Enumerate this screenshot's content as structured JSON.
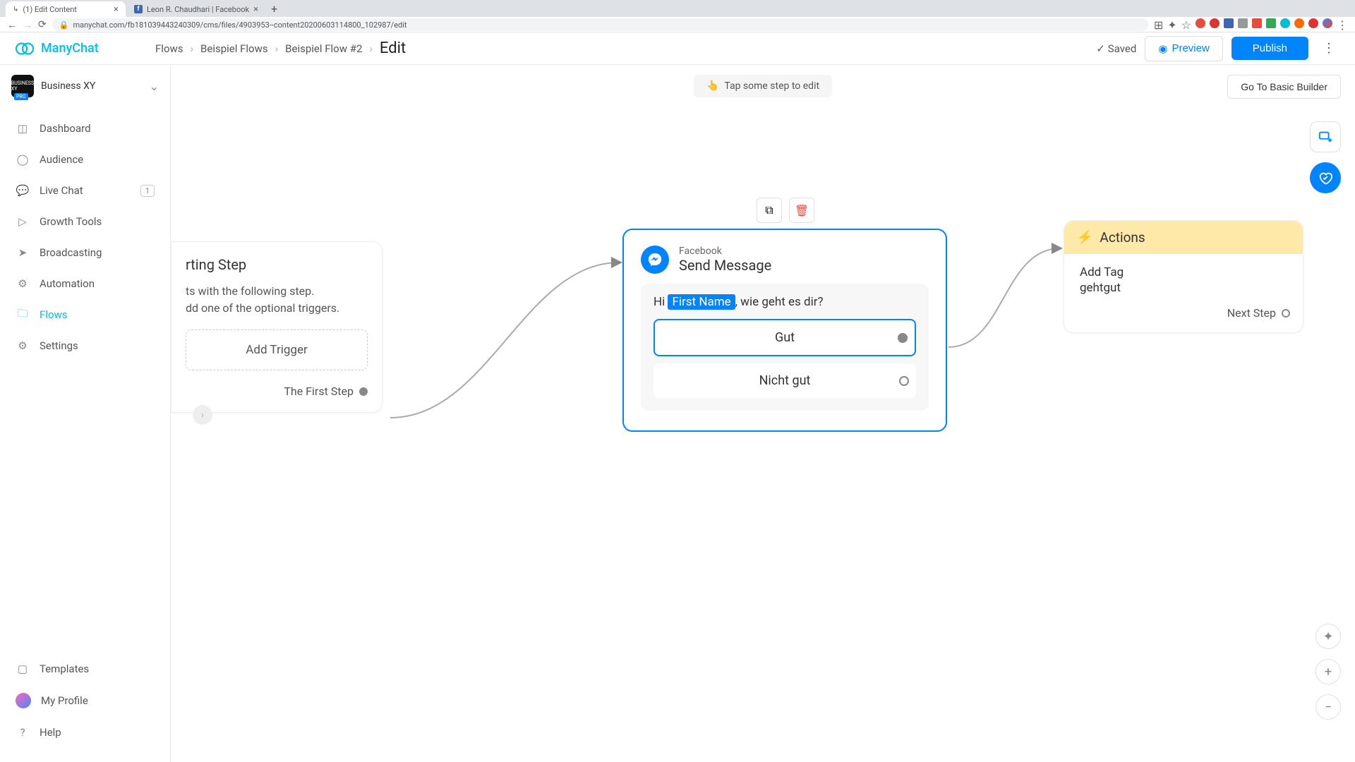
{
  "browser": {
    "tab1": "(1) Edit Content",
    "tab2": "Leon R. Chaudhari | Facebook",
    "url": "manychat.com/fb181039443240309/cms/files/4903953--content20200603114800_102987/edit"
  },
  "logo": "ManyChat",
  "breadcrumbs": {
    "a": "Flows",
    "b": "Beispiel Flows",
    "c": "Beispiel Flow #2",
    "d": "Edit"
  },
  "top": {
    "saved": "Saved",
    "preview": "Preview",
    "publish": "Publish"
  },
  "account": "Business XY",
  "nav": {
    "dashboard": "Dashboard",
    "audience": "Audience",
    "livechat": "Live Chat",
    "livechat_badge": "1",
    "growth": "Growth Tools",
    "broadcasting": "Broadcasting",
    "automation": "Automation",
    "flows": "Flows",
    "settings": "Settings",
    "templates": "Templates",
    "profile": "My Profile",
    "help": "Help"
  },
  "hint": "Tap some step to edit",
  "gotobasic": "Go To Basic Builder",
  "start": {
    "title": "rting Step",
    "desc1": "ts with the following step.",
    "desc2": "dd one of the optional triggers.",
    "add_trigger": "Add Trigger",
    "first_step": "The First Step"
  },
  "msg": {
    "sub": "Facebook",
    "main": "Send Message",
    "pre": "Hi",
    "var": "First Name",
    "post": ", wie geht es dir?",
    "b1": "Gut",
    "b2": "Nicht gut"
  },
  "actions": {
    "title": "Actions",
    "label": "Add Tag",
    "value": "gehtgut",
    "next": "Next Step"
  }
}
